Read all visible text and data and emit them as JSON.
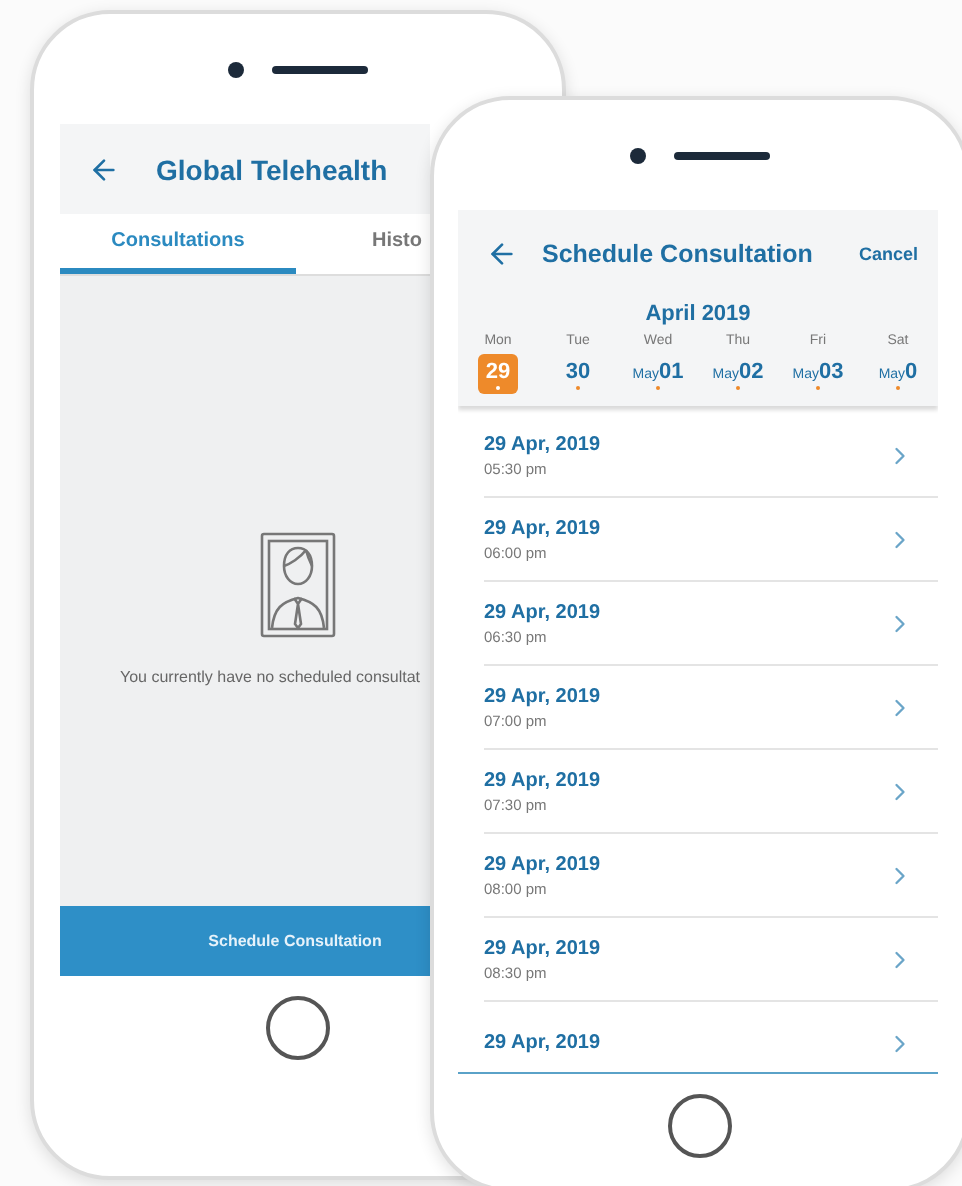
{
  "consultations_screen": {
    "title": "Global Telehealth",
    "tabs": [
      {
        "label": "Consultations",
        "selected": true
      },
      {
        "label": "Histo",
        "selected": false
      }
    ],
    "empty_message": "You currently have no scheduled consultat",
    "action": "Schedule Consultation"
  },
  "schedule_screen": {
    "title": "Schedule Consultation",
    "cancel": "Cancel",
    "month": "April 2019",
    "days": [
      {
        "weekday": "Mon",
        "date": "29",
        "selected": true,
        "available": true
      },
      {
        "weekday": "Tue",
        "date": "30",
        "selected": false,
        "available": true
      },
      {
        "weekday": "Wed",
        "prefix": "May",
        "date": "01",
        "selected": false,
        "available": true
      },
      {
        "weekday": "Thu",
        "prefix": "May",
        "date": "02",
        "selected": false,
        "available": true
      },
      {
        "weekday": "Fri",
        "prefix": "May",
        "date": "03",
        "selected": false,
        "available": true
      },
      {
        "weekday": "Sat",
        "prefix": "May",
        "date": "0",
        "selected": false,
        "available": true
      }
    ],
    "slots": [
      {
        "date": "29 Apr, 2019",
        "time": "05:30 pm"
      },
      {
        "date": "29 Apr, 2019",
        "time": "06:00 pm"
      },
      {
        "date": "29 Apr, 2019",
        "time": "06:30 pm"
      },
      {
        "date": "29 Apr, 2019",
        "time": "07:00 pm"
      },
      {
        "date": "29 Apr, 2019",
        "time": "07:30 pm"
      },
      {
        "date": "29 Apr, 2019",
        "time": "08:00 pm"
      },
      {
        "date": "29 Apr, 2019",
        "time": "08:30 pm"
      },
      {
        "date": "29 Apr, 2019"
      }
    ]
  }
}
